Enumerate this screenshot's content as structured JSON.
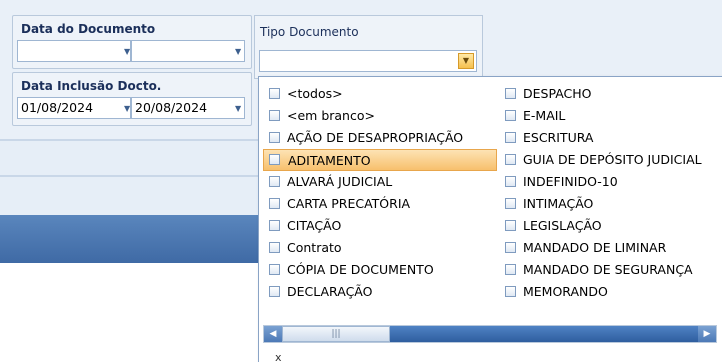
{
  "filters": {
    "data_documento": {
      "label": "Data do Documento",
      "from": "",
      "to": ""
    },
    "data_inclusao": {
      "label": "Data Inclusão Docto.",
      "from": "01/08/2024",
      "to": "20/08/2024"
    }
  },
  "tipo_documento": {
    "label": "Tipo Documento",
    "value": ""
  },
  "dropdown": {
    "left_items": [
      "<todos>",
      "<em branco>",
      "AÇÃO DE DESAPROPRIAÇÃO",
      "ADITAMENTO",
      "ALVARÁ JUDICIAL",
      "CARTA PRECATÓRIA",
      "CITAÇÃO",
      "Contrato",
      "CÓPIA DE DOCUMENTO",
      "DECLARAÇÃO"
    ],
    "right_items": [
      "DESPACHO",
      "E-MAIL",
      "ESCRITURA",
      "GUIA DE DEPÓSITO JUDICIAL",
      "INDEFINIDO-10",
      "INTIMAÇÃO",
      "LEGISLAÇÃO",
      "MANDADO DE  LIMINAR",
      "MANDADO DE SEGURANÇA",
      "MEMORANDO"
    ],
    "highlighted": "ADITAMENTO",
    "close_label": "x"
  },
  "colors": {
    "accent": "#3f6aa5",
    "highlight": "#f7c06d"
  }
}
